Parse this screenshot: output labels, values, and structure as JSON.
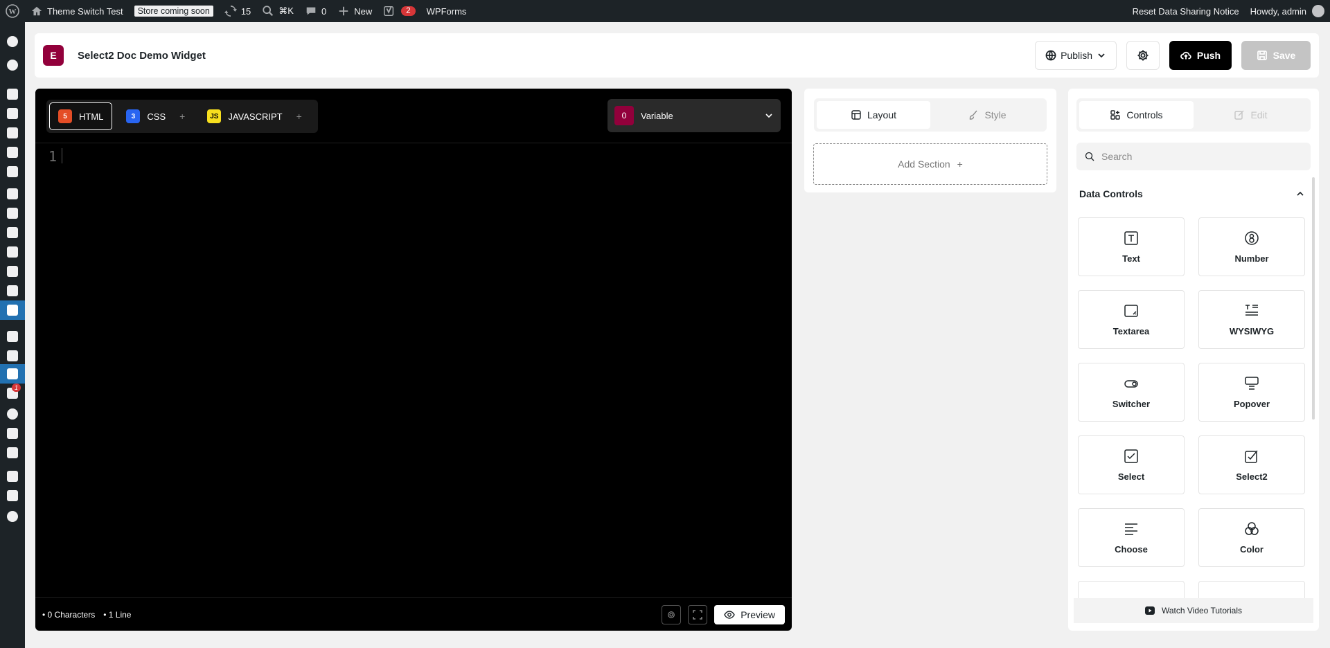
{
  "adminbar": {
    "site_name": "Theme Switch Test",
    "store_badge": "Store coming soon",
    "updates_count": "15",
    "search_shortcut": "⌘K",
    "comments_count": "0",
    "new_label": "New",
    "yoast_count": "2",
    "wpforms_label": "WPForms",
    "reset_notice": "Reset Data Sharing Notice",
    "howdy": "Howdy, admin"
  },
  "adminmenu": {
    "badge": "1"
  },
  "header": {
    "logo_letter": "E",
    "title": "Select2 Doc Demo Widget",
    "publish_label": "Publish",
    "push_label": "Push",
    "save_label": "Save"
  },
  "editor": {
    "tabs": [
      {
        "label": "HTML",
        "icon": "5"
      },
      {
        "label": "CSS",
        "icon": "3"
      },
      {
        "label": "JAVASCRIPT",
        "icon": "JS"
      }
    ],
    "plus": "+",
    "variable_count": "0",
    "variable_label": "Variable",
    "line_number": "1",
    "characters": "• 0 Characters",
    "lines": "• 1 Line",
    "preview_label": "Preview"
  },
  "layout_panel": {
    "tab_layout": "Layout",
    "tab_style": "Style",
    "add_section": "Add Section",
    "add_plus": "+"
  },
  "controls_panel": {
    "tab_controls": "Controls",
    "tab_edit": "Edit",
    "search_placeholder": "Search",
    "group_title": "Data Controls",
    "controls": [
      {
        "label": "Text",
        "icon": "text-icon"
      },
      {
        "label": "Number",
        "icon": "number-icon"
      },
      {
        "label": "Textarea",
        "icon": "textarea-icon"
      },
      {
        "label": "WYSIWYG",
        "icon": "wysiwyg-icon"
      },
      {
        "label": "Switcher",
        "icon": "switcher-icon"
      },
      {
        "label": "Popover",
        "icon": "popover-icon"
      },
      {
        "label": "Select",
        "icon": "select-icon"
      },
      {
        "label": "Select2",
        "icon": "select2-icon"
      },
      {
        "label": "Choose",
        "icon": "choose-icon"
      },
      {
        "label": "Color",
        "icon": "color-icon"
      }
    ],
    "watch_label": "Watch Video Tutorials"
  },
  "colors": {
    "brand": "#92003b",
    "admin_bar": "#1d2327",
    "editor_bg": "#000000",
    "active_menu": "#2271b1"
  }
}
